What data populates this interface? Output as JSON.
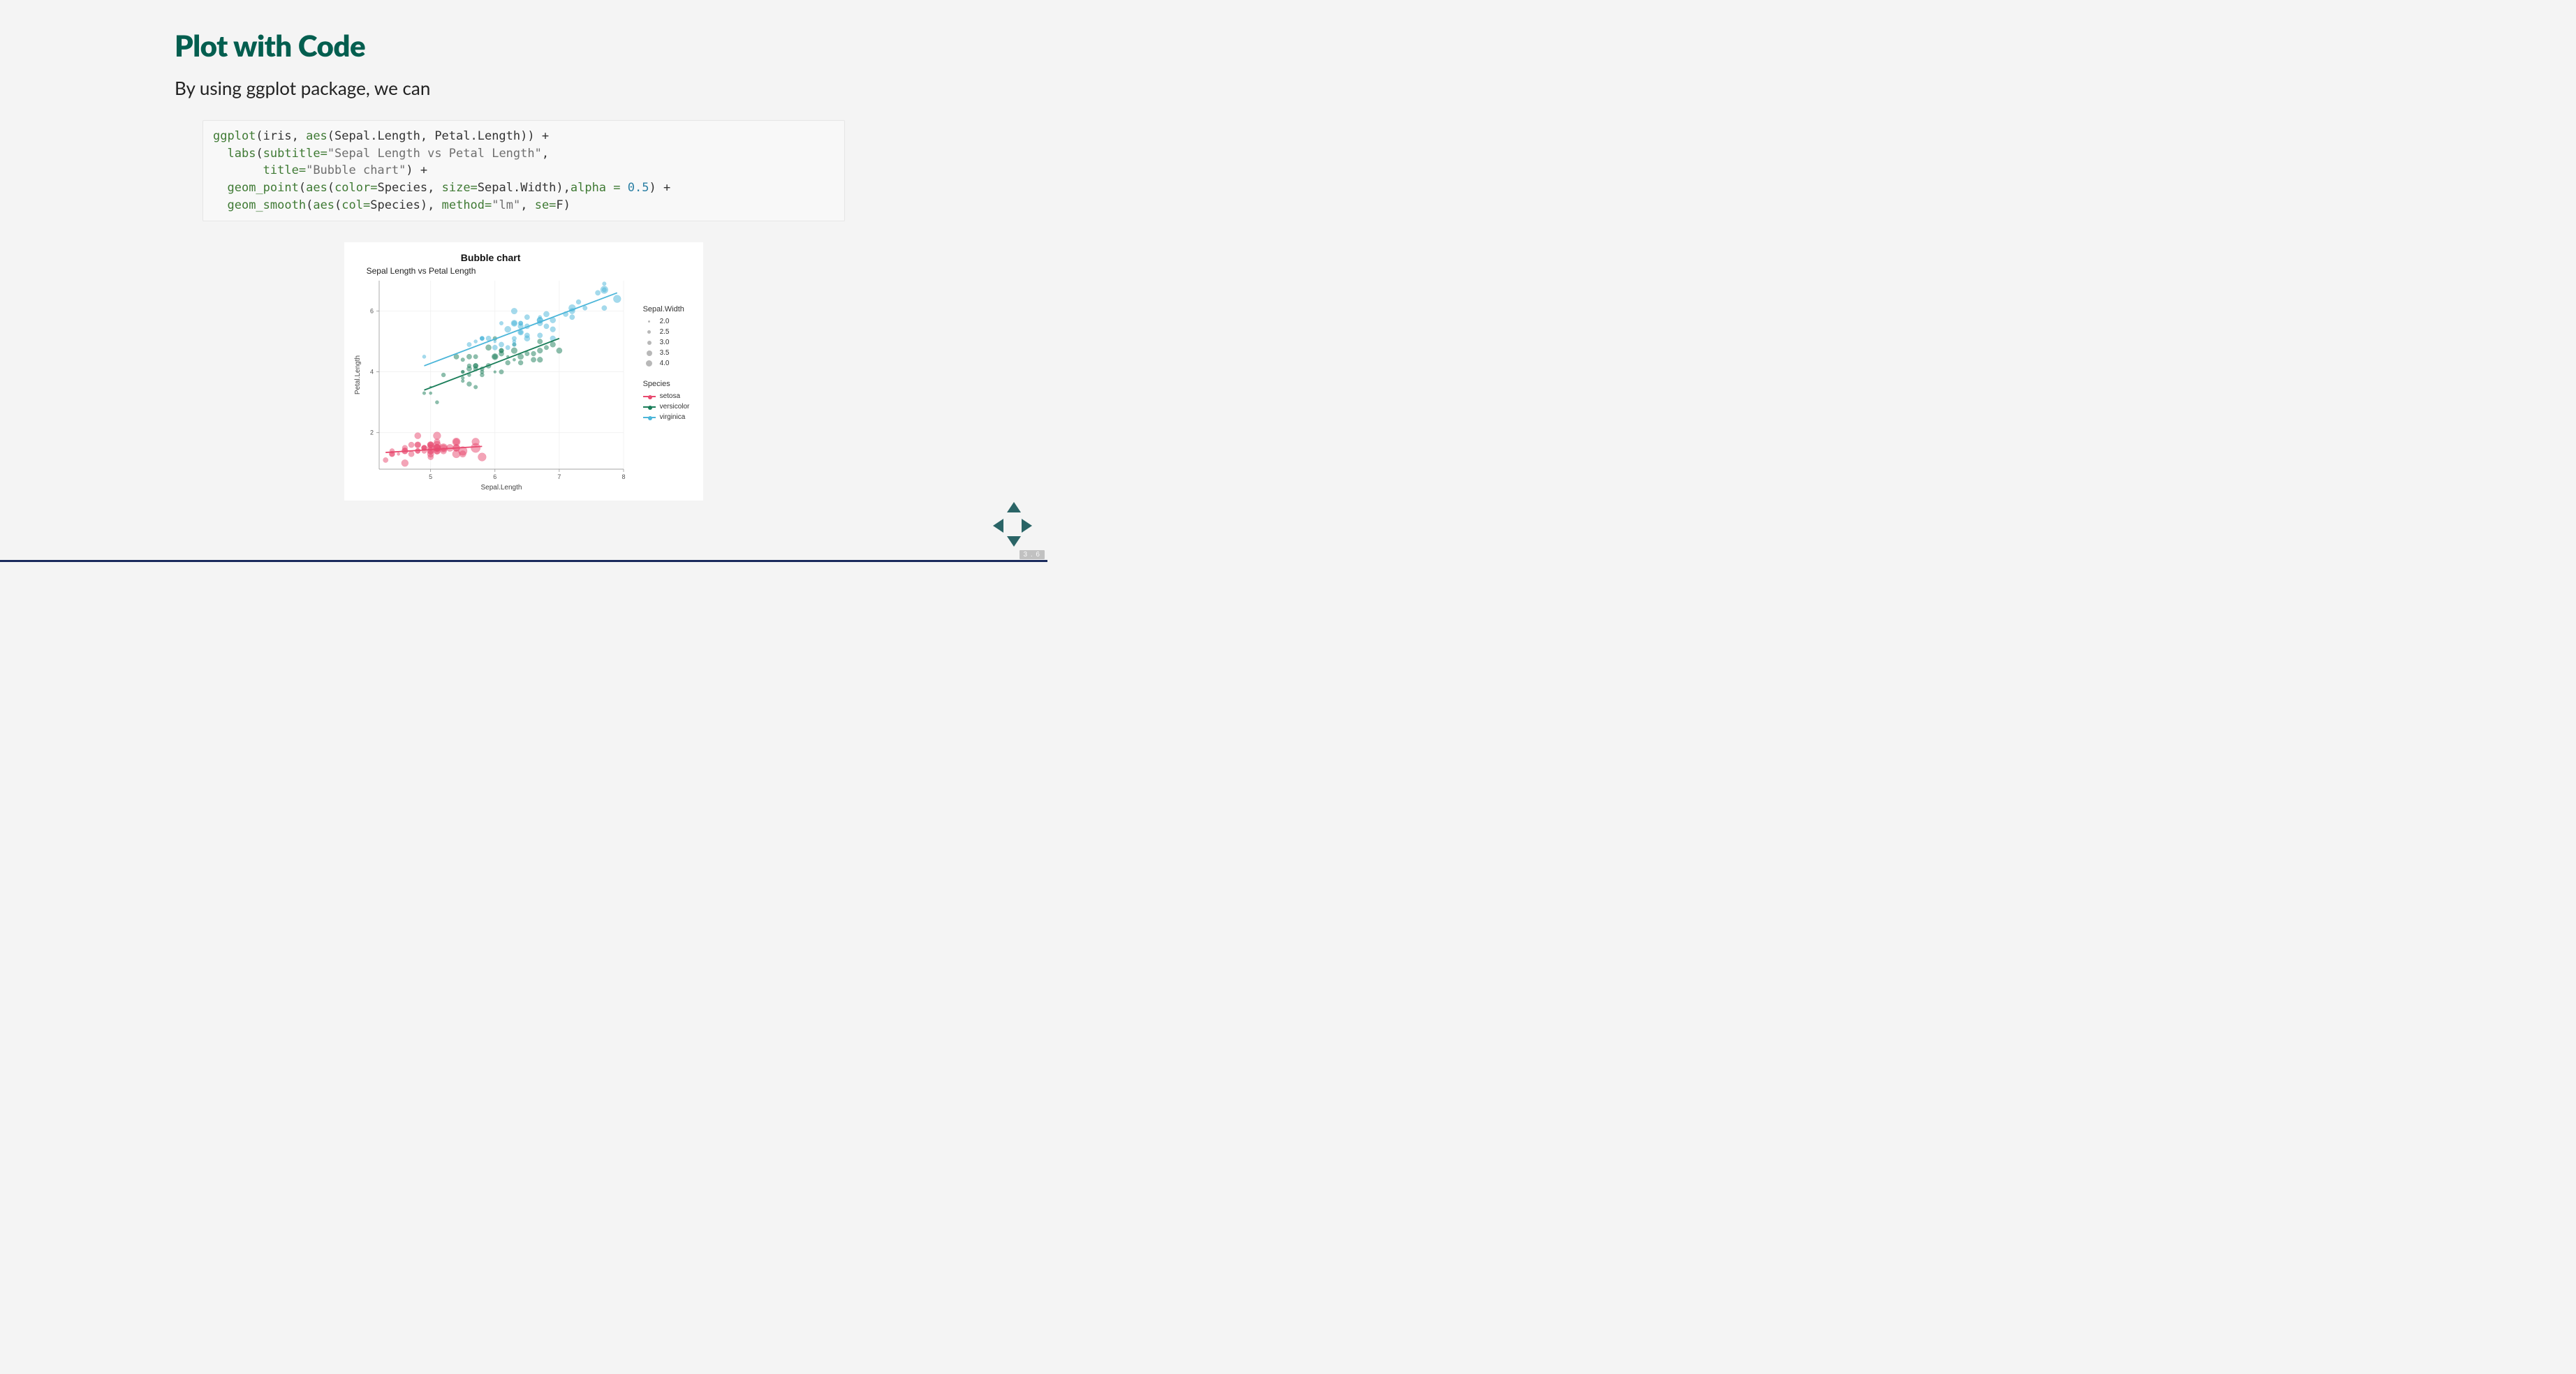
{
  "slide": {
    "title": "Plot with Code",
    "body": "By using ggplot package, we can",
    "pagenum": "3 . 6"
  },
  "code": {
    "tokens": [
      {
        "t": "ggplot",
        "c": "tok-fn"
      },
      {
        "t": "(iris, "
      },
      {
        "t": "aes",
        "c": "tok-fn"
      },
      {
        "t": "(Sepal.Length, Petal.Length)) +\n  "
      },
      {
        "t": "labs",
        "c": "tok-fn"
      },
      {
        "t": "("
      },
      {
        "t": "subtitle=",
        "c": "tok-arg"
      },
      {
        "t": "\"Sepal Length vs Petal Length\"",
        "c": "tok-str"
      },
      {
        "t": ",\n       "
      },
      {
        "t": "title=",
        "c": "tok-arg"
      },
      {
        "t": "\"Bubble chart\"",
        "c": "tok-str"
      },
      {
        "t": ") +\n  "
      },
      {
        "t": "geom_point",
        "c": "tok-fn"
      },
      {
        "t": "("
      },
      {
        "t": "aes",
        "c": "tok-fn"
      },
      {
        "t": "("
      },
      {
        "t": "color=",
        "c": "tok-arg"
      },
      {
        "t": "Species, "
      },
      {
        "t": "size=",
        "c": "tok-arg"
      },
      {
        "t": "Sepal.Width),"
      },
      {
        "t": "alpha = ",
        "c": "tok-arg"
      },
      {
        "t": "0.5",
        "c": "tok-num"
      },
      {
        "t": ") +\n  "
      },
      {
        "t": "geom_smooth",
        "c": "tok-fn"
      },
      {
        "t": "("
      },
      {
        "t": "aes",
        "c": "tok-fn"
      },
      {
        "t": "("
      },
      {
        "t": "col=",
        "c": "tok-arg"
      },
      {
        "t": "Species), "
      },
      {
        "t": "method=",
        "c": "tok-arg"
      },
      {
        "t": "\"lm\"",
        "c": "tok-str"
      },
      {
        "t": ", "
      },
      {
        "t": "se=",
        "c": "tok-arg"
      },
      {
        "t": "F)"
      }
    ]
  },
  "legend": {
    "size_title": "Sepal.Width",
    "size_levels": [
      "2.0",
      "2.5",
      "3.0",
      "3.5",
      "4.0"
    ],
    "species_title": "Species",
    "species": [
      {
        "name": "setosa",
        "color": "#e84a6f"
      },
      {
        "name": "versicolor",
        "color": "#1b7e5a"
      },
      {
        "name": "virginica",
        "color": "#4cb6d9"
      }
    ]
  },
  "chart_data": {
    "type": "scatter",
    "title": "Bubble chart",
    "subtitle": "Sepal Length vs Petal Length",
    "xlabel": "Sepal.Length",
    "ylabel": "Petal.Length",
    "xlim": [
      4.2,
      8.0
    ],
    "ylim": [
      0.8,
      7.0
    ],
    "x_ticks": [
      5,
      6,
      7,
      8
    ],
    "y_ticks": [
      2,
      4,
      6
    ],
    "size_var": "Sepal.Width",
    "series": [
      {
        "name": "setosa",
        "color": "#e84a6f",
        "points": [
          {
            "x": 5.1,
            "y": 1.4,
            "s": 3.5
          },
          {
            "x": 4.9,
            "y": 1.4,
            "s": 3.0
          },
          {
            "x": 4.7,
            "y": 1.3,
            "s": 3.2
          },
          {
            "x": 4.6,
            "y": 1.5,
            "s": 3.1
          },
          {
            "x": 5.0,
            "y": 1.4,
            "s": 3.6
          },
          {
            "x": 5.4,
            "y": 1.7,
            "s": 3.9
          },
          {
            "x": 4.6,
            "y": 1.4,
            "s": 3.4
          },
          {
            "x": 5.0,
            "y": 1.5,
            "s": 3.4
          },
          {
            "x": 4.4,
            "y": 1.4,
            "s": 2.9
          },
          {
            "x": 4.9,
            "y": 1.5,
            "s": 3.1
          },
          {
            "x": 5.4,
            "y": 1.5,
            "s": 3.7
          },
          {
            "x": 4.8,
            "y": 1.6,
            "s": 3.4
          },
          {
            "x": 4.8,
            "y": 1.4,
            "s": 3.0
          },
          {
            "x": 4.3,
            "y": 1.1,
            "s": 3.0
          },
          {
            "x": 5.8,
            "y": 1.2,
            "s": 4.0
          },
          {
            "x": 5.7,
            "y": 1.5,
            "s": 4.4
          },
          {
            "x": 5.4,
            "y": 1.3,
            "s": 3.9
          },
          {
            "x": 5.1,
            "y": 1.4,
            "s": 3.5
          },
          {
            "x": 5.7,
            "y": 1.7,
            "s": 3.8
          },
          {
            "x": 5.1,
            "y": 1.5,
            "s": 3.8
          },
          {
            "x": 5.4,
            "y": 1.7,
            "s": 3.4
          },
          {
            "x": 5.1,
            "y": 1.5,
            "s": 3.7
          },
          {
            "x": 4.6,
            "y": 1.0,
            "s": 3.6
          },
          {
            "x": 5.1,
            "y": 1.7,
            "s": 3.3
          },
          {
            "x": 4.8,
            "y": 1.9,
            "s": 3.4
          },
          {
            "x": 5.0,
            "y": 1.6,
            "s": 3.0
          },
          {
            "x": 5.0,
            "y": 1.6,
            "s": 3.4
          },
          {
            "x": 5.2,
            "y": 1.5,
            "s": 3.5
          },
          {
            "x": 5.2,
            "y": 1.4,
            "s": 3.4
          },
          {
            "x": 4.7,
            "y": 1.6,
            "s": 3.2
          },
          {
            "x": 4.8,
            "y": 1.6,
            "s": 3.1
          },
          {
            "x": 5.4,
            "y": 1.5,
            "s": 3.4
          },
          {
            "x": 5.2,
            "y": 1.5,
            "s": 4.1
          },
          {
            "x": 5.5,
            "y": 1.4,
            "s": 4.2
          },
          {
            "x": 4.9,
            "y": 1.5,
            "s": 3.1
          },
          {
            "x": 5.0,
            "y": 1.2,
            "s": 3.2
          },
          {
            "x": 5.5,
            "y": 1.3,
            "s": 3.5
          },
          {
            "x": 4.9,
            "y": 1.5,
            "s": 3.1
          },
          {
            "x": 4.4,
            "y": 1.3,
            "s": 3.0
          },
          {
            "x": 5.1,
            "y": 1.5,
            "s": 3.4
          },
          {
            "x": 5.0,
            "y": 1.3,
            "s": 3.5
          },
          {
            "x": 4.5,
            "y": 1.3,
            "s": 2.3
          },
          {
            "x": 4.4,
            "y": 1.3,
            "s": 3.2
          },
          {
            "x": 5.0,
            "y": 1.6,
            "s": 3.5
          },
          {
            "x": 5.1,
            "y": 1.9,
            "s": 3.8
          },
          {
            "x": 4.8,
            "y": 1.4,
            "s": 3.0
          },
          {
            "x": 5.1,
            "y": 1.6,
            "s": 3.8
          },
          {
            "x": 4.6,
            "y": 1.4,
            "s": 3.2
          },
          {
            "x": 5.3,
            "y": 1.5,
            "s": 3.7
          },
          {
            "x": 5.0,
            "y": 1.4,
            "s": 3.3
          }
        ],
        "line": {
          "x": [
            4.3,
            5.8
          ],
          "y": [
            1.35,
            1.55
          ]
        }
      },
      {
        "name": "versicolor",
        "color": "#1b7e5a",
        "points": [
          {
            "x": 7.0,
            "y": 4.7,
            "s": 3.2
          },
          {
            "x": 6.4,
            "y": 4.5,
            "s": 3.2
          },
          {
            "x": 6.9,
            "y": 4.9,
            "s": 3.1
          },
          {
            "x": 5.5,
            "y": 4.0,
            "s": 2.3
          },
          {
            "x": 6.5,
            "y": 4.6,
            "s": 2.8
          },
          {
            "x": 5.7,
            "y": 4.5,
            "s": 2.8
          },
          {
            "x": 6.3,
            "y": 4.7,
            "s": 3.3
          },
          {
            "x": 4.9,
            "y": 3.3,
            "s": 2.4
          },
          {
            "x": 6.6,
            "y": 4.6,
            "s": 2.9
          },
          {
            "x": 5.2,
            "y": 3.9,
            "s": 2.7
          },
          {
            "x": 5.0,
            "y": 3.5,
            "s": 2.0
          },
          {
            "x": 5.9,
            "y": 4.2,
            "s": 3.0
          },
          {
            "x": 6.0,
            "y": 4.0,
            "s": 2.2
          },
          {
            "x": 6.1,
            "y": 4.7,
            "s": 2.9
          },
          {
            "x": 5.6,
            "y": 3.6,
            "s": 2.9
          },
          {
            "x": 6.7,
            "y": 4.4,
            "s": 3.1
          },
          {
            "x": 5.6,
            "y": 4.5,
            "s": 3.0
          },
          {
            "x": 5.8,
            "y": 4.1,
            "s": 2.7
          },
          {
            "x": 6.2,
            "y": 4.5,
            "s": 2.2
          },
          {
            "x": 5.6,
            "y": 3.9,
            "s": 2.5
          },
          {
            "x": 5.9,
            "y": 4.8,
            "s": 3.2
          },
          {
            "x": 6.1,
            "y": 4.0,
            "s": 2.8
          },
          {
            "x": 6.3,
            "y": 4.9,
            "s": 2.5
          },
          {
            "x": 6.1,
            "y": 4.7,
            "s": 2.8
          },
          {
            "x": 6.4,
            "y": 4.3,
            "s": 2.9
          },
          {
            "x": 6.6,
            "y": 4.4,
            "s": 3.0
          },
          {
            "x": 6.8,
            "y": 4.8,
            "s": 2.8
          },
          {
            "x": 6.7,
            "y": 5.0,
            "s": 3.0
          },
          {
            "x": 6.0,
            "y": 4.5,
            "s": 2.9
          },
          {
            "x": 5.7,
            "y": 3.5,
            "s": 2.6
          },
          {
            "x": 5.5,
            "y": 3.8,
            "s": 2.4
          },
          {
            "x": 5.5,
            "y": 3.7,
            "s": 2.4
          },
          {
            "x": 5.8,
            "y": 3.9,
            "s": 2.7
          },
          {
            "x": 6.0,
            "y": 5.1,
            "s": 2.7
          },
          {
            "x": 5.4,
            "y": 4.5,
            "s": 3.0
          },
          {
            "x": 6.0,
            "y": 4.5,
            "s": 3.4
          },
          {
            "x": 6.7,
            "y": 4.7,
            "s": 3.1
          },
          {
            "x": 6.3,
            "y": 4.4,
            "s": 2.3
          },
          {
            "x": 5.6,
            "y": 4.1,
            "s": 3.0
          },
          {
            "x": 5.5,
            "y": 4.0,
            "s": 2.5
          },
          {
            "x": 5.5,
            "y": 4.4,
            "s": 2.6
          },
          {
            "x": 6.1,
            "y": 4.6,
            "s": 3.0
          },
          {
            "x": 5.8,
            "y": 4.0,
            "s": 2.6
          },
          {
            "x": 5.0,
            "y": 3.3,
            "s": 2.3
          },
          {
            "x": 5.6,
            "y": 4.2,
            "s": 2.7
          },
          {
            "x": 5.7,
            "y": 4.2,
            "s": 3.0
          },
          {
            "x": 5.7,
            "y": 4.2,
            "s": 2.9
          },
          {
            "x": 6.2,
            "y": 4.3,
            "s": 2.9
          },
          {
            "x": 5.1,
            "y": 3.0,
            "s": 2.5
          },
          {
            "x": 5.7,
            "y": 4.1,
            "s": 2.8
          }
        ],
        "line": {
          "x": [
            4.9,
            7.0
          ],
          "y": [
            3.4,
            5.1
          ]
        }
      },
      {
        "name": "virginica",
        "color": "#4cb6d9",
        "points": [
          {
            "x": 6.3,
            "y": 6.0,
            "s": 3.3
          },
          {
            "x": 5.8,
            "y": 5.1,
            "s": 2.7
          },
          {
            "x": 7.1,
            "y": 5.9,
            "s": 3.0
          },
          {
            "x": 6.3,
            "y": 5.6,
            "s": 2.9
          },
          {
            "x": 6.5,
            "y": 5.8,
            "s": 3.0
          },
          {
            "x": 7.6,
            "y": 6.6,
            "s": 3.0
          },
          {
            "x": 4.9,
            "y": 4.5,
            "s": 2.5
          },
          {
            "x": 7.3,
            "y": 6.3,
            "s": 2.9
          },
          {
            "x": 6.7,
            "y": 5.8,
            "s": 2.5
          },
          {
            "x": 7.2,
            "y": 6.1,
            "s": 3.6
          },
          {
            "x": 6.5,
            "y": 5.1,
            "s": 3.2
          },
          {
            "x": 6.4,
            "y": 5.3,
            "s": 2.7
          },
          {
            "x": 6.8,
            "y": 5.5,
            "s": 3.0
          },
          {
            "x": 5.7,
            "y": 5.0,
            "s": 2.5
          },
          {
            "x": 5.8,
            "y": 5.1,
            "s": 2.8
          },
          {
            "x": 6.4,
            "y": 5.3,
            "s": 3.2
          },
          {
            "x": 6.5,
            "y": 5.5,
            "s": 3.0
          },
          {
            "x": 7.7,
            "y": 6.7,
            "s": 3.8
          },
          {
            "x": 7.7,
            "y": 6.9,
            "s": 2.6
          },
          {
            "x": 6.0,
            "y": 5.0,
            "s": 2.2
          },
          {
            "x": 6.9,
            "y": 5.7,
            "s": 3.2
          },
          {
            "x": 5.6,
            "y": 4.9,
            "s": 2.8
          },
          {
            "x": 7.7,
            "y": 6.7,
            "s": 2.8
          },
          {
            "x": 6.3,
            "y": 4.9,
            "s": 2.7
          },
          {
            "x": 6.7,
            "y": 5.7,
            "s": 3.3
          },
          {
            "x": 7.2,
            "y": 6.0,
            "s": 3.2
          },
          {
            "x": 6.2,
            "y": 4.8,
            "s": 2.8
          },
          {
            "x": 6.1,
            "y": 4.9,
            "s": 3.0
          },
          {
            "x": 6.4,
            "y": 5.6,
            "s": 2.8
          },
          {
            "x": 7.2,
            "y": 5.8,
            "s": 3.0
          },
          {
            "x": 7.4,
            "y": 6.1,
            "s": 2.8
          },
          {
            "x": 7.9,
            "y": 6.4,
            "s": 3.8
          },
          {
            "x": 6.4,
            "y": 5.6,
            "s": 2.8
          },
          {
            "x": 6.3,
            "y": 5.1,
            "s": 2.8
          },
          {
            "x": 6.1,
            "y": 5.6,
            "s": 2.6
          },
          {
            "x": 7.7,
            "y": 6.1,
            "s": 3.0
          },
          {
            "x": 6.3,
            "y": 5.6,
            "s": 3.4
          },
          {
            "x": 6.4,
            "y": 5.5,
            "s": 3.1
          },
          {
            "x": 6.0,
            "y": 4.8,
            "s": 3.0
          },
          {
            "x": 6.9,
            "y": 5.4,
            "s": 3.1
          },
          {
            "x": 6.7,
            "y": 5.6,
            "s": 3.1
          },
          {
            "x": 6.9,
            "y": 5.1,
            "s": 3.1
          },
          {
            "x": 5.8,
            "y": 5.1,
            "s": 2.7
          },
          {
            "x": 6.8,
            "y": 5.9,
            "s": 3.2
          },
          {
            "x": 6.7,
            "y": 5.7,
            "s": 3.3
          },
          {
            "x": 6.7,
            "y": 5.2,
            "s": 3.0
          },
          {
            "x": 6.3,
            "y": 5.0,
            "s": 2.5
          },
          {
            "x": 6.5,
            "y": 5.2,
            "s": 3.0
          },
          {
            "x": 6.2,
            "y": 5.4,
            "s": 3.4
          },
          {
            "x": 5.9,
            "y": 5.1,
            "s": 3.0
          }
        ],
        "line": {
          "x": [
            4.9,
            7.9
          ],
          "y": [
            4.2,
            6.6
          ]
        }
      }
    ]
  }
}
